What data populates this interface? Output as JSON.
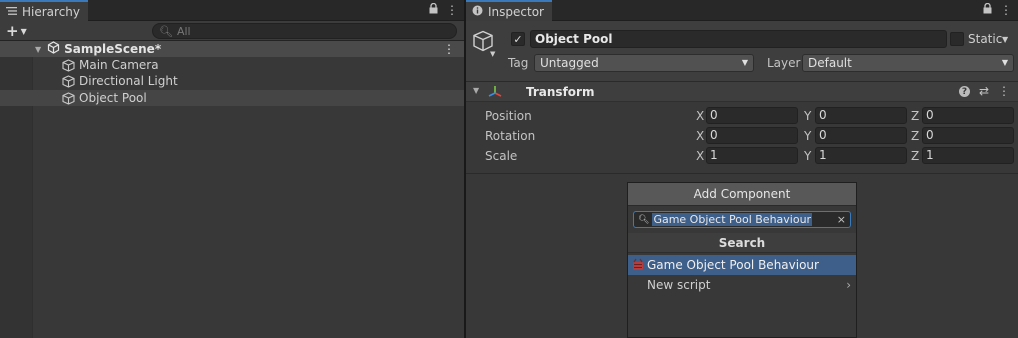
{
  "hierarchy": {
    "tab_label": "Hierarchy",
    "search_placeholder": "All",
    "scene_name": "SampleScene*",
    "items": [
      {
        "label": "Main Camera"
      },
      {
        "label": "Directional Light"
      },
      {
        "label": "Object Pool"
      }
    ]
  },
  "inspector": {
    "tab_label": "Inspector",
    "object_name": "Object Pool",
    "static_label": "Static",
    "tag_label": "Tag",
    "tag_value": "Untagged",
    "layer_label": "Layer",
    "layer_value": "Default",
    "transform": {
      "title": "Transform",
      "rows": [
        {
          "label": "Position",
          "x": "0",
          "y": "0",
          "z": "0"
        },
        {
          "label": "Rotation",
          "x": "0",
          "y": "0",
          "z": "0"
        },
        {
          "label": "Scale",
          "x": "1",
          "y": "1",
          "z": "1"
        }
      ],
      "axis_labels": [
        "X",
        "Y",
        "Z"
      ]
    }
  },
  "add_component": {
    "button_label": "Add Component",
    "search_value": "Game Object Pool Behaviour",
    "header": "Search",
    "results": [
      {
        "label": "Game Object Pool Behaviour",
        "selected": true
      },
      {
        "label": "New script",
        "selected": false
      }
    ]
  },
  "colors": {
    "accent": "#3a79bb",
    "selection": "#3e5f8a",
    "panel_bg": "#383838"
  }
}
